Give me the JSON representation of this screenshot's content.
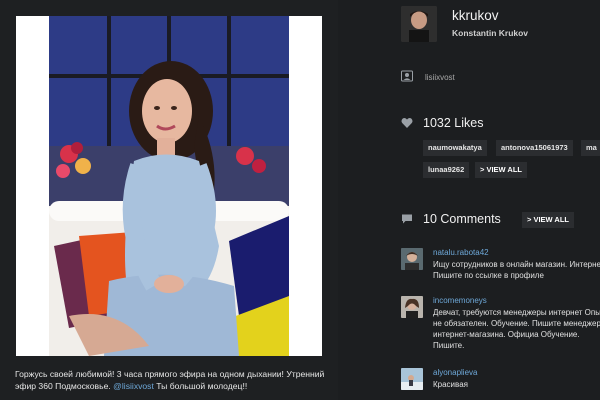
{
  "post": {
    "caption_text": "Горжусь своей любимой! 3 часа прямого эфира на одном дыхании! Утренний эфир 360 Подмосковье.",
    "caption_mention": "@lisiixvost",
    "caption_tail": "Ты большой молодец!!"
  },
  "profile": {
    "username": "kkrukov",
    "full_name": "Konstantin Krukov"
  },
  "tagged": {
    "icon": "person-tag-icon",
    "user": "lisiixvost"
  },
  "likes": {
    "icon": "heart-icon",
    "count_label": "1032 Likes",
    "likers": [
      "naumowakatya",
      "antonova15061973",
      "ma",
      "lunaa9262"
    ],
    "view_all_label": "> VIEW ALL"
  },
  "comments": {
    "icon": "speech-bubble-icon",
    "count_label": "10 Comments",
    "view_all_label": "> VIEW ALL",
    "items": [
      {
        "user": "natalu.rabota42",
        "text": "Ищу сотрудников в онлайн магазин. Интерне Пишите по ссылке в профиле"
      },
      {
        "user": "incomemoneys",
        "text": "Девчат, требуются менеджеры интернет Опыт не обязателен. Обучение. Пишите менеджеры интернет-магазина. Официа Обучение. Пишите."
      },
      {
        "user": "alyonaplieva",
        "text": "Красивая"
      }
    ]
  },
  "colors": {
    "background": "#1c1e20",
    "link": "#6ea8d8",
    "chip": "#2b2d30"
  }
}
